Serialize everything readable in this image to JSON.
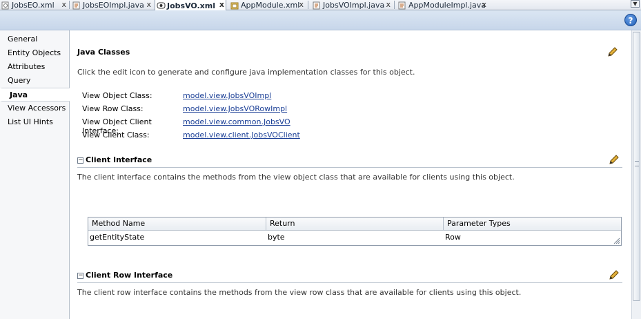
{
  "tabs": [
    {
      "label": "JobsEO.xml",
      "close": "x",
      "icon": "xml-file-icon"
    },
    {
      "label": "JobsEOImpl.java",
      "close": "x",
      "icon": "java-file-icon"
    },
    {
      "label": "JobsVO.xml",
      "close": "x",
      "icon": "view-object-file-icon",
      "active": true
    },
    {
      "label": "AppModule.xml",
      "close": "x",
      "icon": "app-module-file-icon"
    },
    {
      "label": "JobsVOImpl.java",
      "close": "x",
      "icon": "java-file-icon"
    },
    {
      "label": "AppModuleImpl.java",
      "close": "x",
      "icon": "java-file-icon"
    }
  ],
  "help_label": "?",
  "nav": {
    "items": [
      "General",
      "Entity Objects",
      "Attributes",
      "Query",
      "Java",
      "View Accessors",
      "List UI Hints"
    ],
    "selected": "Java"
  },
  "java_classes": {
    "title": "Java Classes",
    "description": "Click the edit icon to generate and configure java implementation classes for this object.",
    "rows": [
      {
        "label": "View Object Class:",
        "value": "model.view.JobsVOImpl"
      },
      {
        "label": "View Row Class:",
        "value": "model.view.JobsVORowImpl"
      },
      {
        "label": "View Object Client Interface:",
        "value": "model.view.common.JobsVO"
      },
      {
        "label": "View Client Class:",
        "value": "model.view.client.JobsVOClient"
      }
    ]
  },
  "client_interface": {
    "toggle": "−",
    "title": "Client Interface",
    "description": "The client interface contains the methods from the view object class that are available for clients using this object.",
    "columns": [
      "Method Name",
      "Return",
      "Parameter Types"
    ],
    "rows": [
      [
        "getEntityState",
        "byte",
        "Row"
      ]
    ]
  },
  "client_row_interface": {
    "toggle": "−",
    "title": "Client Row Interface",
    "description": "The client row interface contains the methods from the view row class that are available for clients using this object."
  },
  "colors": {
    "link": "#1b3f96",
    "header_band": "#c7d6ea",
    "pencil": "#d49a1a"
  }
}
